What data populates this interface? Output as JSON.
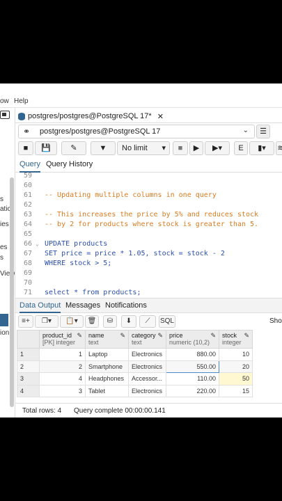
{
  "menu": {
    "items": [
      "ow",
      "Help"
    ]
  },
  "left_panel": {
    "fragments": [
      "s",
      "atic",
      "ies",
      "es",
      "s",
      "View",
      "ion"
    ]
  },
  "tab": {
    "title": "postgres/postgres@PostgreSQL 17*",
    "close": "✕"
  },
  "connection": {
    "value": "postgres/postgres@PostgreSQL 17"
  },
  "toolbar": {
    "limit_label": "No limit"
  },
  "editor_tabs": [
    "Query",
    "Query History"
  ],
  "editor": {
    "lines": [
      {
        "n": "59",
        "text": ""
      },
      {
        "n": "60",
        "text": ""
      },
      {
        "n": "61",
        "text": "-- Updating multiple columns in one query"
      },
      {
        "n": "62",
        "text": ""
      },
      {
        "n": "63",
        "text": "-- This increases the price by 5% and reduces stock"
      },
      {
        "n": "64",
        "text": "-- by 2 for products where stock is greater than 5."
      },
      {
        "n": "65",
        "text": ""
      },
      {
        "n": "66",
        "text": "UPDATE products"
      },
      {
        "n": "67",
        "text": "SET price = price * 1.05, stock = stock - 2"
      },
      {
        "n": "68",
        "text": "WHERE stock > 5;"
      },
      {
        "n": "69",
        "text": ""
      },
      {
        "n": "70",
        "text": ""
      },
      {
        "n": "71",
        "text": "select * from products;"
      }
    ]
  },
  "result_tabs": [
    "Data Output",
    "Messages",
    "Notifications"
  ],
  "grid_toolbar": {
    "sql_label": "SQL",
    "show_label": "Sho"
  },
  "grid": {
    "columns": [
      {
        "name": "product_id",
        "type": "[PK] integer"
      },
      {
        "name": "name",
        "type": "text"
      },
      {
        "name": "category",
        "type": "text"
      },
      {
        "name": "price",
        "type": "numeric (10,2)"
      },
      {
        "name": "stock",
        "type": "integer"
      }
    ],
    "rows": [
      {
        "rn": "1",
        "product_id": "1",
        "name": "Laptop",
        "category": "Electronics",
        "price": "880.00",
        "stock": "10"
      },
      {
        "rn": "2",
        "product_id": "2",
        "name": "Smartphone",
        "category": "Electronics",
        "price": "550.00",
        "stock": "20"
      },
      {
        "rn": "3",
        "product_id": "4",
        "name": "Headphones",
        "category": "Accessor...",
        "price": "110.00",
        "stock": "50"
      },
      {
        "rn": "4",
        "product_id": "3",
        "name": "Tablet",
        "category": "Electronics",
        "price": "220.00",
        "stock": "15"
      }
    ]
  },
  "status": {
    "total_rows": "Total rows: 4",
    "query_time": "Query complete 00:00:00.141"
  }
}
